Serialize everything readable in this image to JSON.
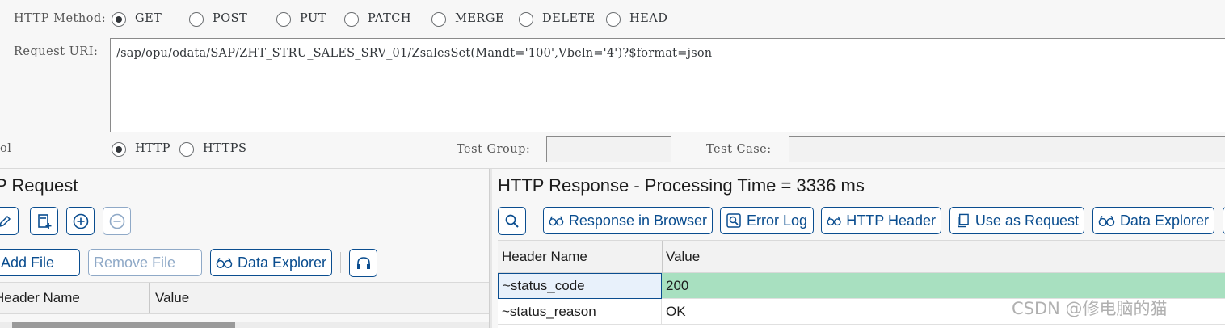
{
  "method": {
    "label": "HTTP Method:",
    "options": [
      "GET",
      "POST",
      "PUT",
      "PATCH",
      "MERGE",
      "DELETE",
      "HEAD"
    ],
    "selected": "GET"
  },
  "request_uri": {
    "label": "Request URI:",
    "value": "/sap/opu/odata/SAP/ZHT_STRU_SALES_SRV_01/ZsalesSet(Mandt='100',Vbeln='4')?$format=json"
  },
  "protocol": {
    "label": "ol",
    "options": [
      "HTTP",
      "HTTPS"
    ],
    "selected": "HTTP"
  },
  "test_group": {
    "label": "Test Group:",
    "value": ""
  },
  "test_case": {
    "label": "Test Case:",
    "value": ""
  },
  "request_panel": {
    "title": "P Request",
    "add_file": "Add File",
    "remove_file": "Remove File",
    "data_explorer": "Data Explorer",
    "table_headers": [
      "Header Name",
      "Value"
    ]
  },
  "response_panel": {
    "title": "HTTP Response - Processing Time = 3336  ms",
    "buttons": {
      "response_in_browser": "Response in Browser",
      "error_log": "Error Log",
      "http_header": "HTTP Header",
      "use_as_request": "Use as Request",
      "data_explorer": "Data Explorer"
    },
    "table_headers": [
      "Header Name",
      "Value"
    ],
    "rows": [
      {
        "name": "~status_code",
        "value": "200"
      },
      {
        "name": "~status_reason",
        "value": "OK"
      }
    ]
  },
  "colors": {
    "status_ok": "#a8e0c0",
    "accent": "#0a4d8f"
  },
  "watermark": "CSDN @修电脑的猫"
}
